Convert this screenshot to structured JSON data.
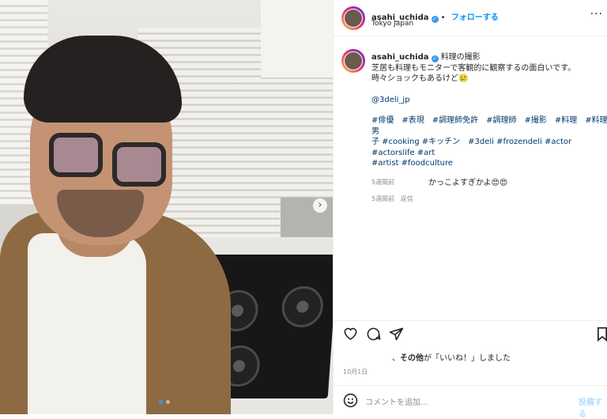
{
  "post": {
    "username": "asahi_uchida",
    "follow_label": "フォローする",
    "location": "Tokyo Japan",
    "more_label": "···"
  },
  "caption": {
    "username": "asahi_uchida",
    "line1": "料理の撮影",
    "line2": "芝居も料理もモニターで客観的に観察するの面白いです。",
    "line3": "時々ショックもあるけど🥲",
    "mention": "@3deli_jp",
    "hashtags_1": "#俳優　#表現　#調理師免許　#調理師　#撮影　#料理　#料理男",
    "hashtags_2": "子 #cooking #キッチン　#3deli #frozendeli #actor #actorslife #art",
    "hashtags_3": "#artist #foodculture",
    "time": "5週間前"
  },
  "comment": {
    "text": "かっこよすぎかよ😍😍",
    "time": "5週間前",
    "reply_label": "返信"
  },
  "likes": {
    "prefix": "、",
    "bold": "その他",
    "suffix": "が「いいね！」しました"
  },
  "date": "10月1日",
  "comment_input": {
    "placeholder": "コメントを追加...",
    "post_label": "投稿する"
  },
  "carousel": {
    "next_label": "›",
    "total": 2,
    "current": 1
  },
  "colors": {
    "link": "#00376b",
    "follow": "#0095f6",
    "muted": "#8e8e8e"
  }
}
